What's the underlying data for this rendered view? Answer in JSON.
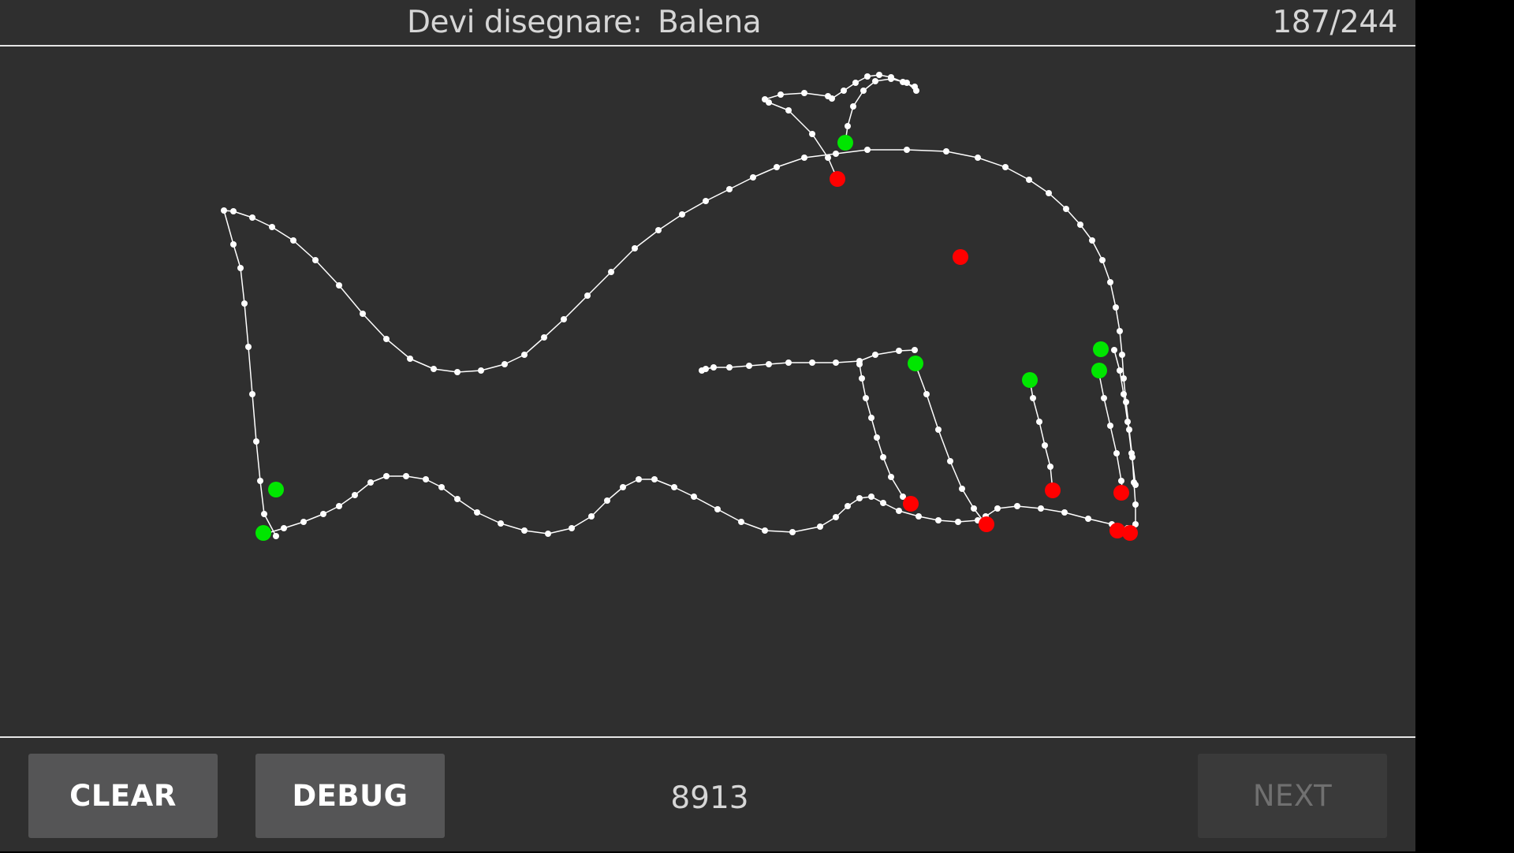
{
  "header": {
    "prompt": "Devi disegnare:",
    "word": "Balena",
    "progress": "187/244"
  },
  "footer": {
    "clear_label": "CLEAR",
    "debug_label": "DEBUG",
    "counter": "8913",
    "next_label": "NEXT"
  },
  "colors": {
    "background": "#2f2f2f",
    "stroke": "#ffffff",
    "start_marker": "#00e600",
    "end_marker": "#ff0000",
    "button": "#555556"
  },
  "next_enabled": false
}
